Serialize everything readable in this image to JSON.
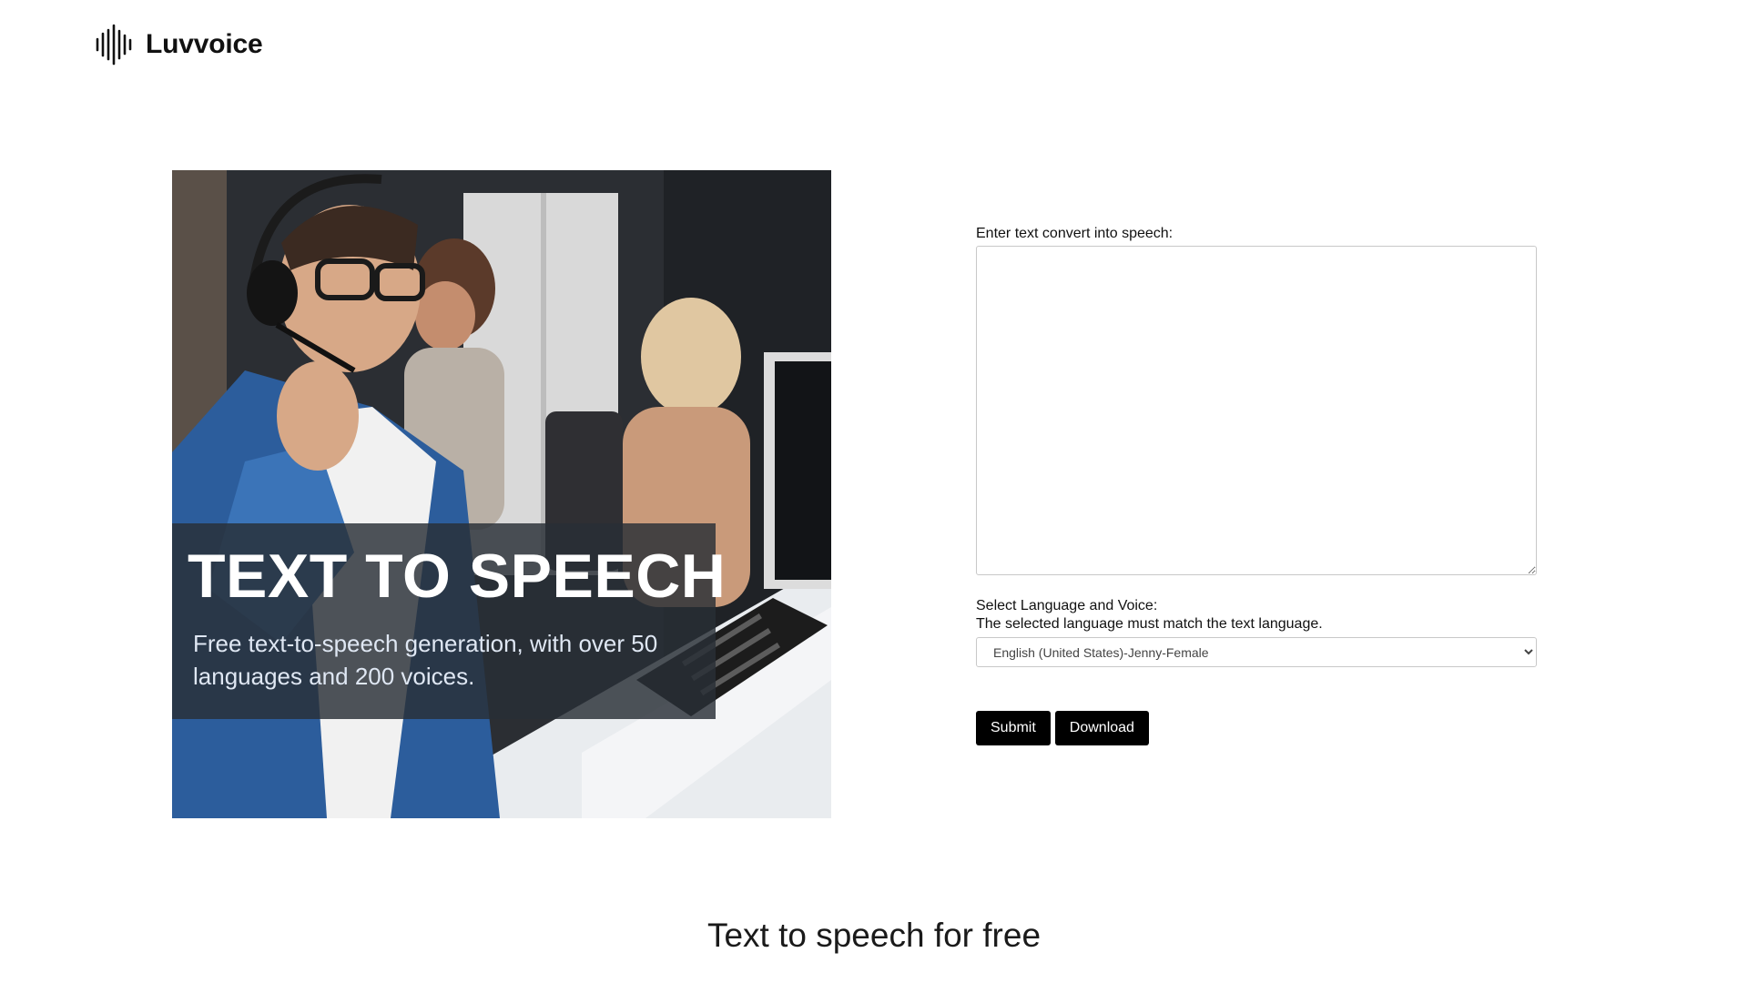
{
  "brand": {
    "name": "Luvvoice",
    "icon": "soundwave-icon"
  },
  "hero": {
    "title": "TEXT TO SPEECH",
    "subtitle": "Free text-to-speech generation, with over 50 languages and 200 voices."
  },
  "form": {
    "text_label": "Enter text convert into speech:",
    "text_value": "",
    "language_label": "Select Language and Voice:",
    "language_note": "The selected language must match the text language.",
    "voice_selected": "English (United States)-Jenny-Female",
    "submit_label": "Submit",
    "download_label": "Download"
  },
  "footer": {
    "heading": "Text to speech for free"
  }
}
